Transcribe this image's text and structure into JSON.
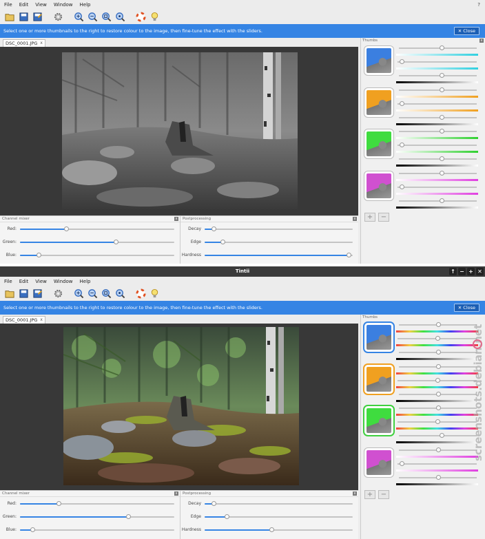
{
  "app": {
    "title": "Tintii"
  },
  "menu": [
    "File",
    "Edit",
    "View",
    "Window",
    "Help"
  ],
  "help_mark": "?",
  "toolbar_icons": [
    "open-icon",
    "save-icon",
    "save-as-icon",
    "settings-icon",
    "zoom-in-icon",
    "zoom-out-icon",
    "zoom-fit-icon",
    "zoom-actual-icon",
    "help-icon",
    "tip-icon"
  ],
  "info": {
    "message": "Select one or more thumbnails to the right to restore colour to the image, then fine-tune the effect with the sliders.",
    "close_label": "Close",
    "close_glyph": "✕"
  },
  "tab": {
    "label": "DSC_0001.JPG",
    "close": "x"
  },
  "channel_mixer": {
    "title": "Channel mixer",
    "close": "x",
    "sliders": [
      {
        "label": "Red:"
      },
      {
        "label": "Green:"
      },
      {
        "label": "Blue:"
      }
    ]
  },
  "postprocessing": {
    "title": "Postprocessing",
    "close": "x",
    "sliders": [
      {
        "label": "Decay"
      },
      {
        "label": "Edge"
      },
      {
        "label": "Hardness"
      }
    ]
  },
  "thumbs": {
    "title": "Thumbs",
    "close": "x",
    "add": "+",
    "remove": "−"
  },
  "window1": {
    "channel_values": [
      0.3,
      0.62,
      0.12
    ],
    "post_values": [
      0.06,
      0.12,
      0.97
    ],
    "thumbs": [
      {
        "color": "#3b7fe0",
        "sliders": [
          0.55,
          0.05,
          0.55,
          0.0
        ],
        "grad": "cyan"
      },
      {
        "color": "#f0a020",
        "sliders": [
          0.55,
          0.05,
          0.55,
          0.0
        ],
        "grad": "orange"
      },
      {
        "color": "#3fdc3f",
        "sliders": [
          0.55,
          0.05,
          0.55,
          0.0
        ],
        "grad": "green"
      },
      {
        "color": "#d050d0",
        "sliders": [
          0.55,
          0.05,
          0.55,
          0.0
        ],
        "grad": "magenta"
      }
    ]
  },
  "window2": {
    "channel_values": [
      0.25,
      0.7,
      0.08
    ],
    "post_values": [
      0.06,
      0.15,
      0.45
    ],
    "thumbs": [
      {
        "color": "#3b7fe0",
        "sliders": [
          0.5,
          0.5,
          0.5,
          0.0
        ],
        "grad": "rainbow",
        "selected": true,
        "ring": "#3584e4"
      },
      {
        "color": "#f0a020",
        "sliders": [
          0.5,
          0.5,
          0.5,
          0.0
        ],
        "grad": "rainbow",
        "selected": true,
        "ring": "#f0a020"
      },
      {
        "color": "#3fdc3f",
        "sliders": [
          0.5,
          0.5,
          0.55,
          0.0
        ],
        "grad": "rainbow",
        "selected": true,
        "ring": "#3fcf3f"
      },
      {
        "color": "#d050d0",
        "sliders": [
          0.5,
          0.05,
          0.5,
          0.0
        ],
        "grad": "magenta",
        "selected": false
      }
    ]
  },
  "watermark": "screenshots.debian.net"
}
